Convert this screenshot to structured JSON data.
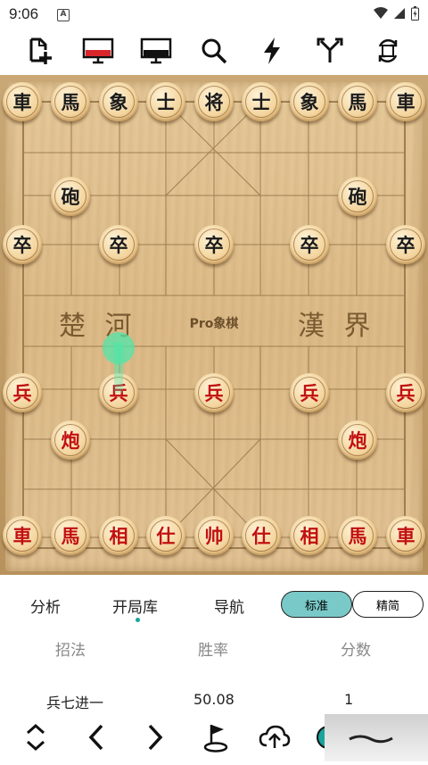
{
  "status": {
    "time": "9:06",
    "notif_glyph": "A"
  },
  "toolbar": {
    "icons": [
      "new-game-icon",
      "red-screen-icon",
      "black-screen-icon",
      "search-icon",
      "lightning-icon",
      "branch-icon",
      "rotate-icon"
    ]
  },
  "board": {
    "river_left": "楚 河",
    "river_right": "漢 界",
    "brand": "Pro象棋",
    "black_back": [
      "車",
      "馬",
      "象",
      "士",
      "将",
      "士",
      "象",
      "馬",
      "車"
    ],
    "black_cannon": "砲",
    "black_soldier": "卒",
    "red_back": [
      "車",
      "馬",
      "相",
      "仕",
      "帅",
      "仕",
      "相",
      "馬",
      "車"
    ],
    "red_cannon": "炮",
    "red_soldier": "兵"
  },
  "tabs": {
    "analysis": "分析",
    "opening": "开局库",
    "nav": "导航",
    "standard": "标准",
    "simple": "精简"
  },
  "table": {
    "headers": [
      "招法",
      "胜率",
      "分数"
    ],
    "rows": [
      [
        "兵七进一",
        "50.08",
        "1"
      ]
    ]
  },
  "colors": {
    "accent": "#79c9c8",
    "red_piece": "#c21010",
    "black_piece": "#1b1b1b",
    "hint": "#50e6aa"
  }
}
